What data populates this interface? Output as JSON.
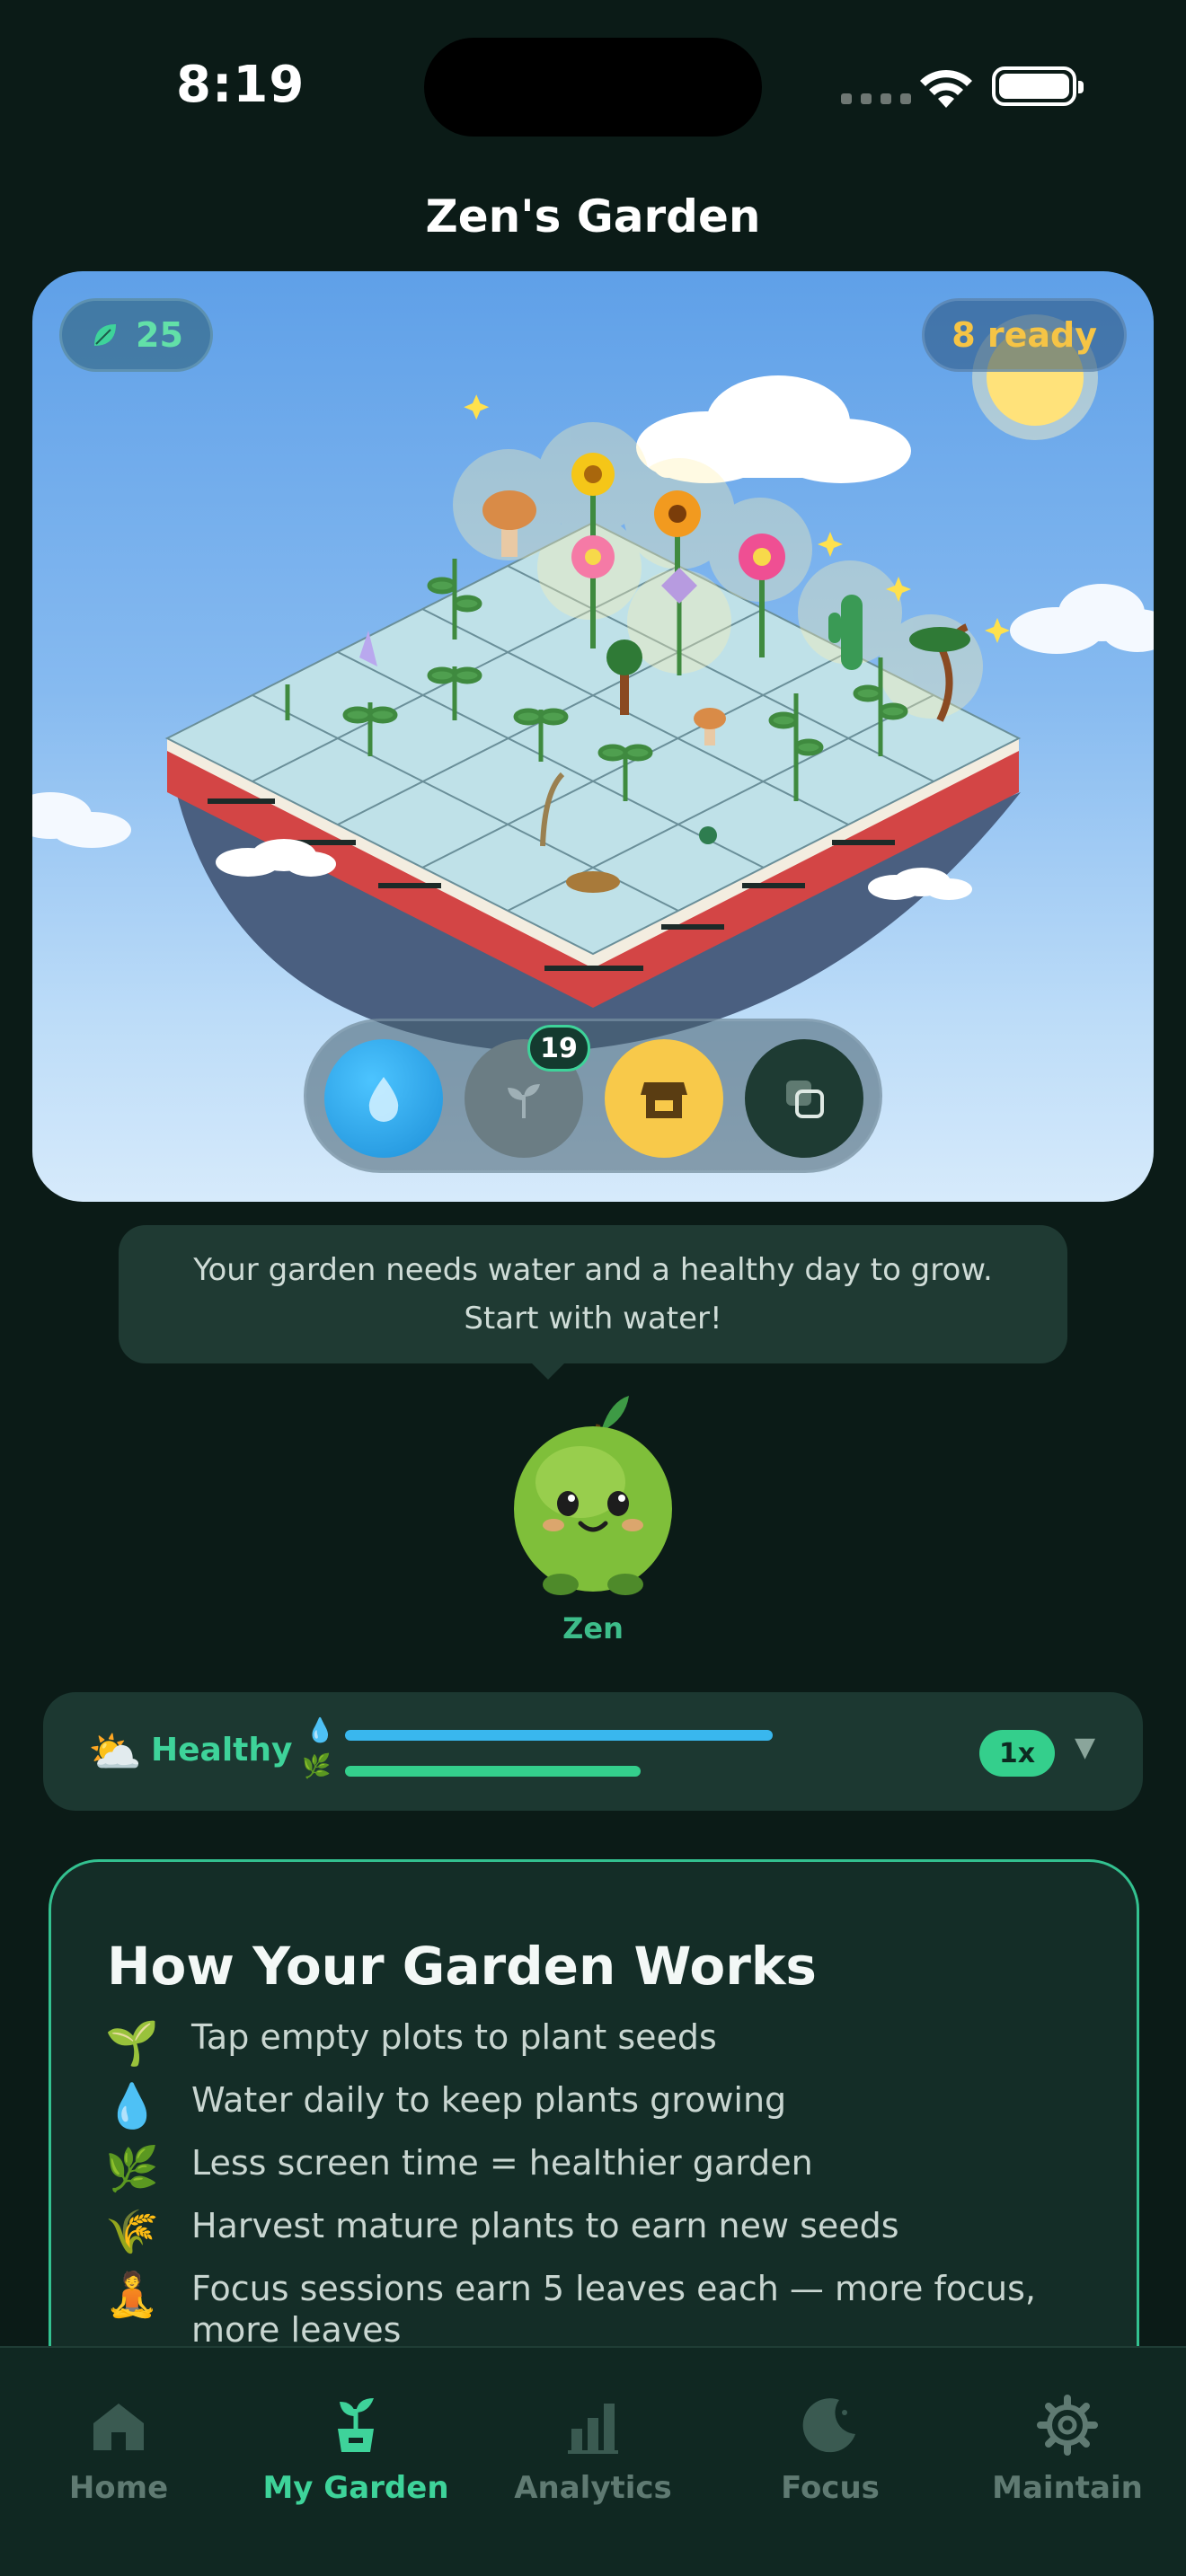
{
  "status_bar": {
    "time": "8:19"
  },
  "header": {
    "title": "Zen's Garden"
  },
  "garden": {
    "leaves_count": "25",
    "ready_label": "8 ready",
    "plant_badge_count": "19",
    "actions": [
      {
        "name": "water",
        "icon": "water-drop-icon"
      },
      {
        "name": "plant",
        "icon": "sprout-icon"
      },
      {
        "name": "shop",
        "icon": "shop-icon"
      },
      {
        "name": "layout",
        "icon": "layers-icon"
      }
    ]
  },
  "tooltip": {
    "line1": "Your garden needs water and a healthy day to grow.",
    "line2": "Start with water!"
  },
  "mascot": {
    "name": "Zen"
  },
  "health": {
    "weather_icon": "⛅",
    "label": "Healthy",
    "water_level": 0.55,
    "health_level": 0.38,
    "speed": "1x",
    "dropdown_glyph": "▼"
  },
  "how_it_works": {
    "title": "How Your Garden Works",
    "items": [
      {
        "emoji": "🌱",
        "text": "Tap empty plots to plant seeds"
      },
      {
        "emoji": "💧",
        "text": "Water daily to keep plants growing"
      },
      {
        "emoji": "🌿",
        "text": "Less screen time = healthier garden"
      },
      {
        "emoji": "🌾",
        "text": "Harvest mature plants to earn new seeds"
      },
      {
        "emoji": "🧘",
        "text": "Focus sessions earn 5 leaves each — more focus, more leaves"
      }
    ]
  },
  "tabs": [
    {
      "label": "Home",
      "icon": "home-icon"
    },
    {
      "label": "My Garden",
      "icon": "garden-icon"
    },
    {
      "label": "Analytics",
      "icon": "analytics-icon"
    },
    {
      "label": "Focus",
      "icon": "moon-icon"
    },
    {
      "label": "Maintain",
      "icon": "gear-icon"
    }
  ],
  "colors": {
    "accent": "#3ed39a",
    "background": "#0b1b17",
    "water": "#39b7ee",
    "ready": "#f6c445"
  }
}
